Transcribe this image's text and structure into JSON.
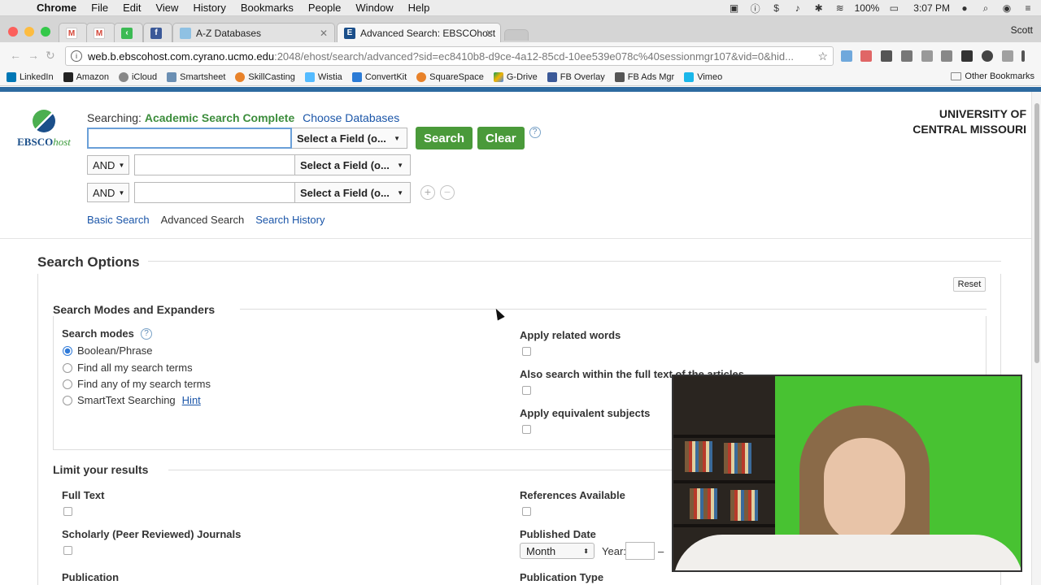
{
  "menubar": {
    "app": "Chrome",
    "items": [
      "File",
      "Edit",
      "View",
      "History",
      "Bookmarks",
      "People",
      "Window",
      "Help"
    ],
    "battery": "100%",
    "time": "3:07 PM"
  },
  "tabs": [
    {
      "label": "",
      "icon": "gmail-icon"
    },
    {
      "label": "",
      "icon": "gmail-icon"
    },
    {
      "label": "",
      "icon": "green-app-icon"
    },
    {
      "label": "",
      "icon": "facebook-icon"
    },
    {
      "label": "A-Z Databases",
      "icon": "page-icon"
    },
    {
      "label": "Advanced Search: EBSCOhost",
      "icon": "ebsco-e-icon"
    }
  ],
  "profile_name": "Scott",
  "address": {
    "host": "web.b.ebscohost.com.cyrano.ucmo.edu",
    "path": ":2048/ehost/search/advanced?sid=ec8410b8-d9ce-4a12-85cd-10ee539e078c%40sessionmgr107&vid=0&hid..."
  },
  "bookmarks": [
    "LinkedIn",
    "Amazon",
    "iCloud",
    "Smartsheet",
    "SkillCasting",
    "Wistia",
    "ConvertKit",
    "SquareSpace",
    "G-Drive",
    "FB Overlay",
    "FB Ads Mgr",
    "Vimeo"
  ],
  "other_bookmarks": "Other Bookmarks",
  "colors": {
    "accent_green": "#4a9a3a",
    "link_blue": "#1a55a8",
    "header_bar": "#2d6aa0"
  },
  "ebsco": {
    "logo_main": "EBSCO",
    "logo_host": "host",
    "searching_label": "Searching:",
    "database": "Academic Search Complete",
    "choose_databases": "Choose Databases",
    "field_select": "Select a Field (o...",
    "search_button": "Search",
    "clear_button": "Clear",
    "help": "?",
    "operators": [
      "AND",
      "AND"
    ],
    "add": "+",
    "remove": "−",
    "links": {
      "basic": "Basic Search",
      "advanced": "Advanced Search",
      "history": "Search History"
    },
    "university_line1": "UNIVERSITY OF",
    "university_line2": "CENTRAL MISSOURI"
  },
  "options": {
    "title": "Search Options",
    "reset": "Reset",
    "modes_title": "Search Modes and Expanders",
    "search_modes_label": "Search modes",
    "modes": [
      "Boolean/Phrase",
      "Find all my search terms",
      "Find any of my search terms",
      "SmartText Searching"
    ],
    "hint": "Hint",
    "expanders": [
      "Apply related words",
      "Also search within the full text of the articles",
      "Apply equivalent subjects"
    ],
    "limit_title": "Limit your results",
    "full_text": "Full Text",
    "scholarly": "Scholarly (Peer Reviewed) Journals",
    "publication": "Publication",
    "references": "References Available",
    "published_date": "Published Date",
    "month": "Month",
    "year_label": "Year:",
    "dash": "–",
    "publication_type": "Publication Type"
  }
}
